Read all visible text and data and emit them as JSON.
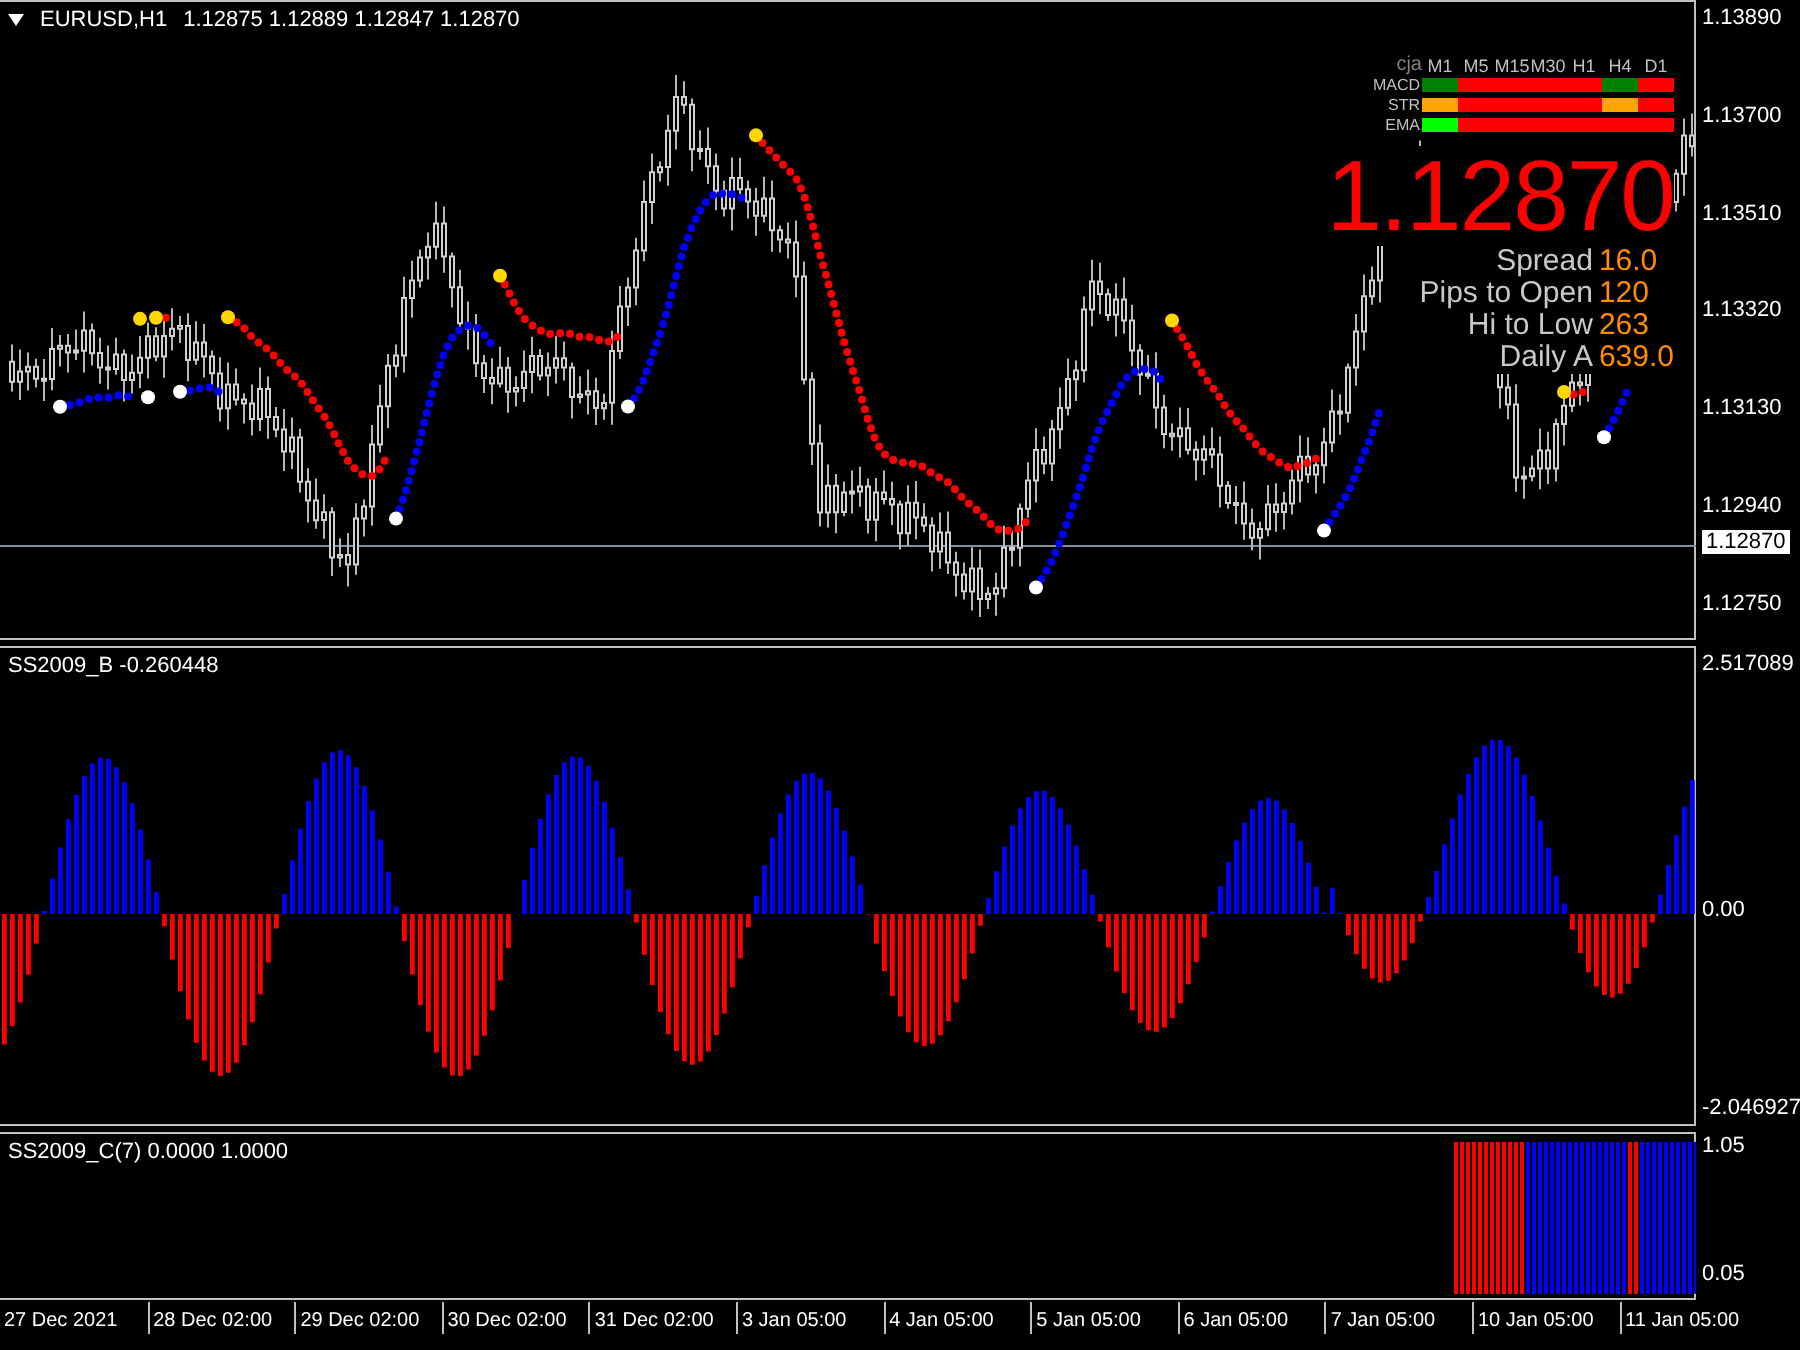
{
  "main_pane": {
    "title": "EURUSD,H1",
    "ohlc": "1.12875 1.12889 1.12847 1.12870",
    "price_axis": [
      "1.13890",
      "1.13700",
      "1.13510",
      "1.13320",
      "1.13130",
      "1.12940",
      "1.12750"
    ],
    "current_price": "1.12870",
    "dashboard": {
      "corner": "cja",
      "timeframes": [
        "M1",
        "M5",
        "M15",
        "M30",
        "H1",
        "H4",
        "D1"
      ],
      "rows": [
        {
          "label": "MACD",
          "cells": [
            {
              "color": "#008000"
            },
            {
              "color": "#ff0000"
            },
            {
              "color": "#ff0000"
            },
            {
              "color": "#ff0000"
            },
            {
              "color": "#ff0000"
            },
            {
              "color": "#008000"
            },
            {
              "color": "#ff0000"
            }
          ]
        },
        {
          "label": "STR",
          "cells": [
            {
              "color": "#ffa500"
            },
            {
              "color": "#ff0000"
            },
            {
              "color": "#ff0000"
            },
            {
              "color": "#ff0000"
            },
            {
              "color": "#ff0000"
            },
            {
              "color": "#ffa500"
            },
            {
              "color": "#ff0000"
            }
          ]
        },
        {
          "label": "EMA",
          "cells": [
            {
              "color": "#00ff00"
            },
            {
              "color": "#ff0000"
            },
            {
              "color": "#ff0000"
            },
            {
              "color": "#ff0000"
            },
            {
              "color": "#ff0000"
            },
            {
              "color": "#ff0000"
            },
            {
              "color": "#ff0000"
            }
          ]
        }
      ]
    },
    "big_price": "1.12870",
    "stats": [
      {
        "label": "Spread",
        "value": "16.0"
      },
      {
        "label": "Pips to Open",
        "value": "120"
      },
      {
        "label": "Hi to Low",
        "value": "263"
      },
      {
        "label": "Daily A",
        "value": "639.0"
      }
    ]
  },
  "histogram_pane": {
    "label": "SS2009_B -0.260448",
    "axis": [
      "2.517089",
      "0.00",
      "-2.046927"
    ]
  },
  "signal_pane": {
    "label": "SS2009_C(7) 0.0000 1.0000",
    "axis": [
      "1.05",
      "0.05"
    ]
  },
  "time_axis": [
    "27 Dec 2021",
    "28 Dec 02:00",
    "29 Dec 02:00",
    "30 Dec 02:00",
    "31 Dec 02:00",
    "3 Jan 05:00",
    "4 Jan 05:00",
    "5 Jan 05:00",
    "6 Jan 05:00",
    "7 Jan 05:00",
    "10 Jan 05:00",
    "11 Jan 05:00"
  ]
}
